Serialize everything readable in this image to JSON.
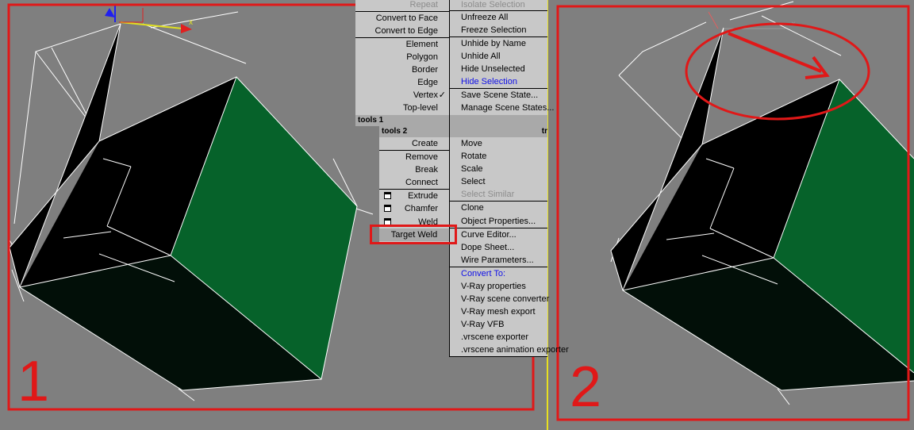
{
  "quad_left_top": {
    "items": [
      {
        "label": "Repeat",
        "dim": true
      },
      {
        "label": "Convert to Face"
      },
      {
        "label": "Convert to Edge"
      },
      {
        "label": "Element"
      },
      {
        "label": "Polygon"
      },
      {
        "label": "Border"
      },
      {
        "label": "Edge"
      },
      {
        "label": "Vertex",
        "checked": true
      },
      {
        "label": "Top-level"
      }
    ]
  },
  "quad_right_top": {
    "items": [
      {
        "label": "Isolate Selection",
        "dim": true
      },
      {
        "label": "Unfreeze All"
      },
      {
        "label": "Freeze Selection"
      },
      {
        "label": "Unhide by Name"
      },
      {
        "label": "Unhide All"
      },
      {
        "label": "Hide Unselected"
      },
      {
        "label": "Hide Selection",
        "highlight": true
      },
      {
        "label": "Save Scene State..."
      },
      {
        "label": "Manage Scene States..."
      }
    ]
  },
  "headers": {
    "tools1": "tools 1",
    "tools2": "tools 2",
    "tr": "tr"
  },
  "quad_left_bottom": {
    "items": [
      {
        "label": "Create"
      },
      {
        "label": "Remove"
      },
      {
        "label": "Break"
      },
      {
        "label": "Connect"
      },
      {
        "label": "Extrude",
        "box": true
      },
      {
        "label": "Chamfer",
        "box": true
      },
      {
        "label": "Weld",
        "box": true
      },
      {
        "label": "Target Weld"
      }
    ]
  },
  "quad_right_bottom": {
    "items": [
      {
        "label": "Move"
      },
      {
        "label": "Rotate"
      },
      {
        "label": "Scale"
      },
      {
        "label": "Select"
      },
      {
        "label": "Select Similar",
        "dim": true
      },
      {
        "label": "Clone"
      },
      {
        "label": "Object Properties..."
      },
      {
        "label": "Curve Editor..."
      },
      {
        "label": "Dope Sheet..."
      },
      {
        "label": "Wire Parameters..."
      },
      {
        "label": "Convert To:",
        "highlight": true
      },
      {
        "label": "V-Ray properties"
      },
      {
        "label": "V-Ray scene converter"
      },
      {
        "label": "V-Ray mesh export"
      },
      {
        "label": "V-Ray VFB"
      },
      {
        "label": ".vrscene exporter"
      },
      {
        "label": ".vrscene animation exporter"
      }
    ]
  },
  "axis_label": "x",
  "annotations": {
    "step1": "1",
    "step2": "2"
  },
  "colors": {
    "viewport": "#7f7f7f",
    "face_green": "#06622a",
    "face_black": "#000000",
    "annotation_red": "#e01818",
    "divider_yellow": "#e8e020",
    "menu_bg": "#c8c8c8",
    "highlight_blue": "#1010e8"
  }
}
